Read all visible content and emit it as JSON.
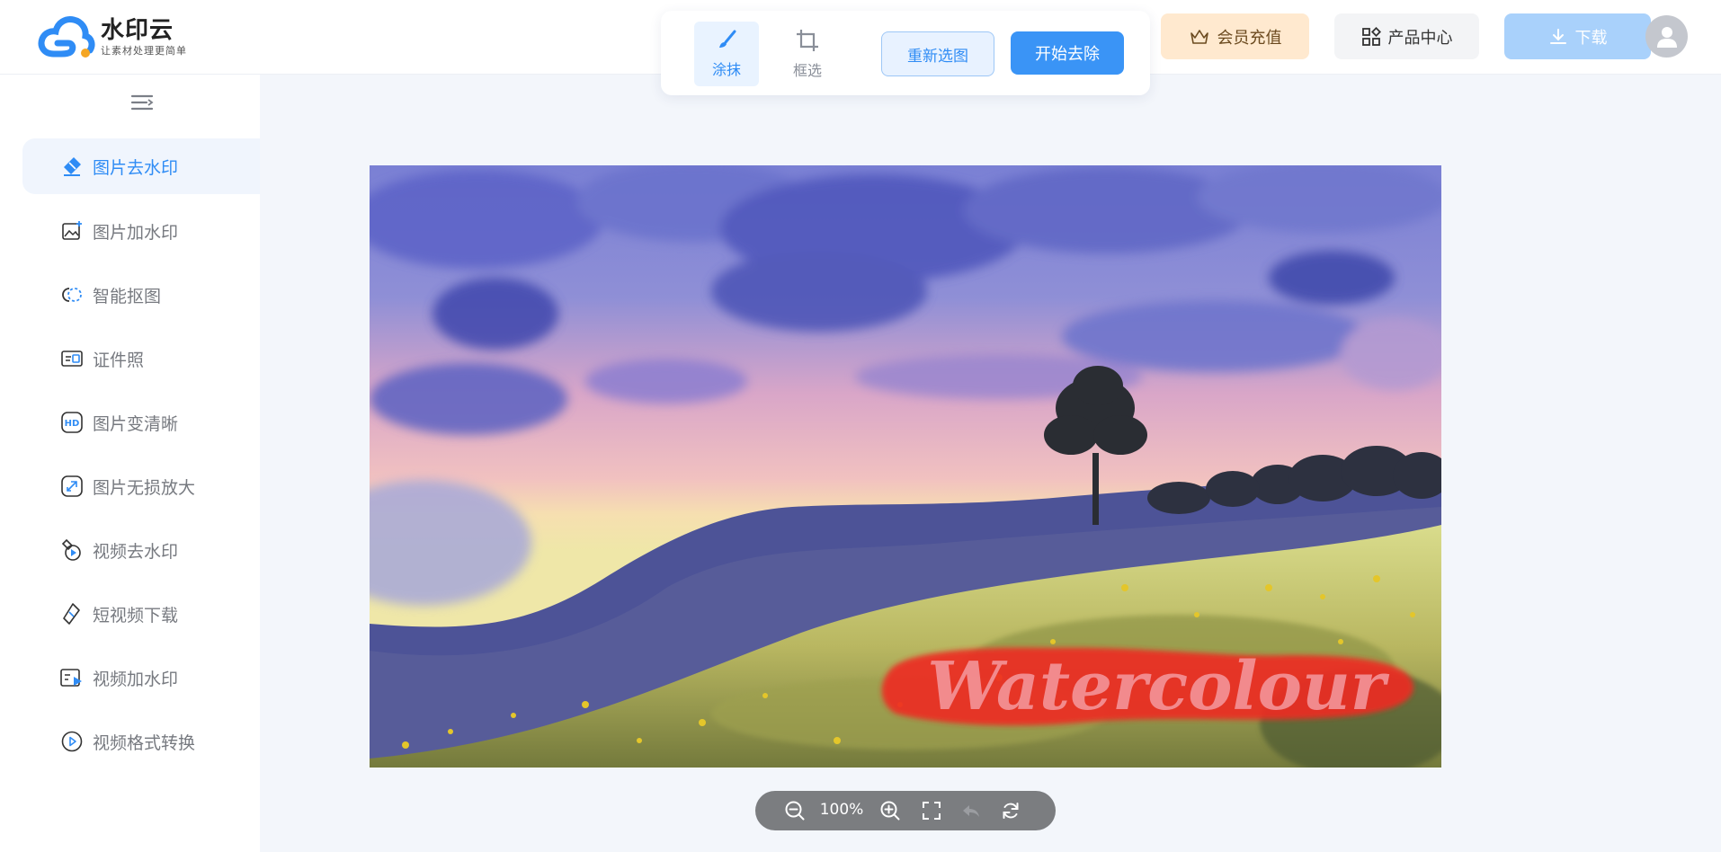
{
  "brand": {
    "name": "水印云",
    "tagline": "让素材处理更简单"
  },
  "toolbar": {
    "tools": [
      {
        "label": "涂抹",
        "active": true
      },
      {
        "label": "框选",
        "active": false
      }
    ],
    "reselect_label": "重新选图",
    "start_label": "开始去除"
  },
  "header": {
    "vip_label": "会员充值",
    "products_label": "产品中心",
    "download_label": "下载"
  },
  "sidebar": {
    "items": [
      {
        "label": "图片去水印",
        "icon": "eraser-icon",
        "active": true
      },
      {
        "label": "图片加水印",
        "icon": "image-add-icon",
        "active": false
      },
      {
        "label": "智能抠图",
        "icon": "cutout-icon",
        "active": false
      },
      {
        "label": "证件照",
        "icon": "id-card-icon",
        "active": false
      },
      {
        "label": "图片变清晰",
        "icon": "hd-icon",
        "active": false
      },
      {
        "label": "图片无损放大",
        "icon": "enlarge-icon",
        "active": false
      },
      {
        "label": "视频去水印",
        "icon": "video-eraser-icon",
        "active": false
      },
      {
        "label": "短视频下载",
        "icon": "link-icon",
        "active": false
      },
      {
        "label": "视频加水印",
        "icon": "video-add-icon",
        "active": false
      },
      {
        "label": "视频格式转换",
        "icon": "play-circle-icon",
        "active": false
      }
    ]
  },
  "canvas": {
    "watermark_text": "Watercolour"
  },
  "zoom": {
    "level": "100%"
  },
  "colors": {
    "accent": "#3a94f6",
    "vip_bg": "#ffe9cf",
    "download_bg": "#a9d1fb",
    "brush_mask": "#ee2b22"
  }
}
